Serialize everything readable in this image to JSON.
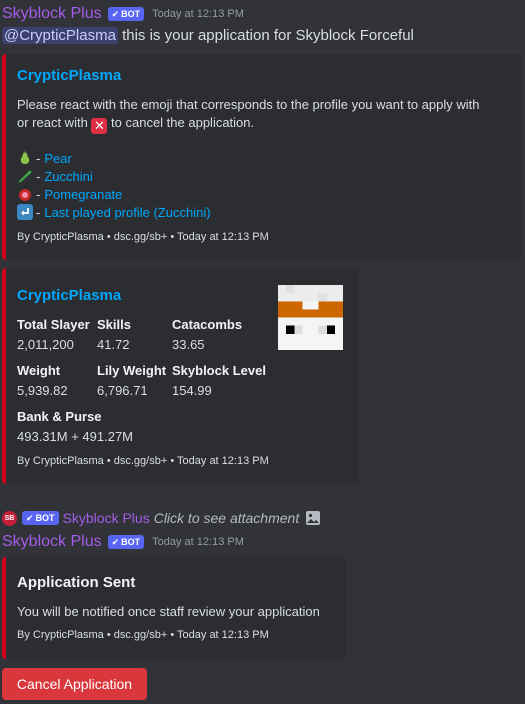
{
  "message1": {
    "username": "Skyblock Plus",
    "bot_badge": "BOT",
    "timestamp": "Today at 12:13 PM",
    "mention": "@CrypticPlasma",
    "text": " this is your application for Skyblock Forceful"
  },
  "embed1": {
    "title": "CrypticPlasma",
    "desc_line1": "Please react with the emoji that corresponds to the profile you want to apply with",
    "desc_line2a": "or react with ",
    "desc_line2b": " to cancel the application.",
    "cancel_emoji": "✕",
    "options": [
      {
        "name": "Pear",
        "icon": "pear-icon"
      },
      {
        "name": "Zucchini",
        "icon": "zucchini-icon"
      },
      {
        "name": "Pomegranate",
        "icon": "pomegranate-icon"
      },
      {
        "name": "Last played profile (Zucchini)",
        "icon": "return-arrow-icon"
      }
    ],
    "dash": "-",
    "footer": "By CrypticPlasma • dsc.gg/sb+ • Today at 12:13 PM"
  },
  "embed2": {
    "title": "CrypticPlasma",
    "fields": [
      {
        "name": "Total Slayer",
        "value": "2,011,200"
      },
      {
        "name": "Skills",
        "value": "41.72"
      },
      {
        "name": "Catacombs",
        "value": "33.65"
      },
      {
        "name": "Weight",
        "value": "5,939.82"
      },
      {
        "name": "Lily Weight",
        "value": "6,796.71"
      },
      {
        "name": "Skyblock Level",
        "value": "154.99"
      },
      {
        "name": "Bank & Purse",
        "value": "493.31M + 491.27M"
      }
    ],
    "footer": "By CrypticPlasma • dsc.gg/sb+ • Today at 12:13 PM"
  },
  "reply_line": {
    "icon_text": "SB",
    "bot_badge": "BOT",
    "username": "Skyblock Plus",
    "text": "Click to see attachment"
  },
  "message2": {
    "username": "Skyblock Plus",
    "bot_badge": "BOT",
    "timestamp": "Today at 12:13 PM"
  },
  "embed3": {
    "title": "Application Sent",
    "text": "You will be notified once staff review your application",
    "footer": "By CrypticPlasma • dsc.gg/sb+ • Today at 12:13 PM"
  },
  "button": {
    "label": "Cancel Application"
  },
  "colors": {
    "accent": "#d0021b",
    "link": "#00a8fc",
    "username": "#a45ce8",
    "button": "#da373c"
  }
}
